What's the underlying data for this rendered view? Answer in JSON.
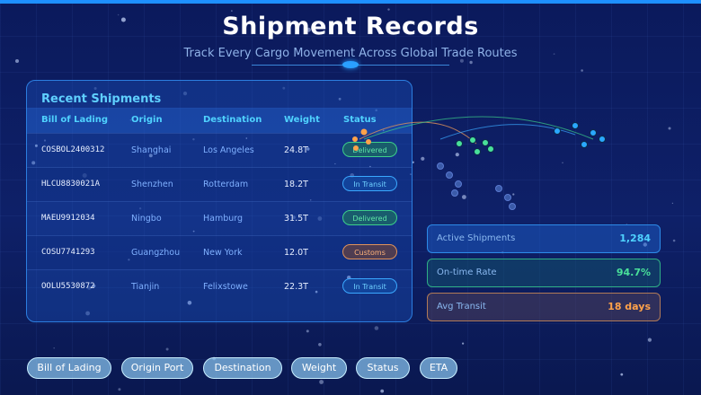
{
  "header": {
    "title": "Shipment Records",
    "subtitle": "Track Every Cargo Movement Across Global Trade Routes"
  },
  "table": {
    "title": "Recent Shipments",
    "columns": [
      "Bill of Lading",
      "Origin",
      "Destination",
      "Weight",
      "Status"
    ],
    "rows": [
      {
        "bol": "COSBOL2400312",
        "origin": "Shanghai",
        "destination": "Los Angeles",
        "weight": "24.8T",
        "status": "Delivered",
        "status_type": "delivered"
      },
      {
        "bol": "HLCU8830021A",
        "origin": "Shenzhen",
        "destination": "Rotterdam",
        "weight": "18.2T",
        "status": "In Transit",
        "status_type": "transit"
      },
      {
        "bol": "MAEU9912034",
        "origin": "Ningbo",
        "destination": "Hamburg",
        "weight": "31.5T",
        "status": "Delivered",
        "status_type": "delivered"
      },
      {
        "bol": "COSU7741293",
        "origin": "Guangzhou",
        "destination": "New York",
        "weight": "12.0T",
        "status": "Customs",
        "status_type": "customs"
      },
      {
        "bol": "OOLU5530872",
        "origin": "Tianjin",
        "destination": "Felixstowe",
        "weight": "22.3T",
        "status": "In Transit",
        "status_type": "transit"
      }
    ]
  },
  "stats": {
    "active_label": "Active Shipments",
    "active_value": "1,284",
    "ontime_label": "On-time Rate",
    "ontime_value": "94.7%",
    "transit_label": "Avg Transit",
    "transit_value": "18 days"
  },
  "chips": [
    "Bill of Lading",
    "Origin Port",
    "Destination",
    "Weight",
    "Status",
    "ETA"
  ],
  "colors": {
    "accent": "#1e90ff",
    "cyan": "#4fd2ff",
    "green": "#49e09a",
    "orange": "#ffa24a"
  }
}
